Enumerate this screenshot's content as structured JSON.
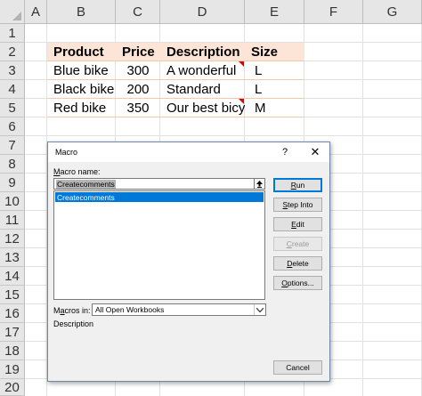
{
  "sheet": {
    "columns": [
      "A",
      "B",
      "C",
      "D",
      "E",
      "F",
      "G"
    ],
    "rows": [
      "1",
      "2",
      "3",
      "4",
      "5",
      "6",
      "7",
      "8",
      "9",
      "10",
      "11",
      "12",
      "13",
      "14",
      "15",
      "16",
      "17",
      "18",
      "19",
      "20"
    ],
    "table": {
      "headers": [
        "Product",
        "Price",
        "Description",
        "Size"
      ],
      "rows": [
        [
          "Blue bike",
          "300",
          "A wonderful",
          "L"
        ],
        [
          "Black bike",
          "200",
          "Standard",
          "L"
        ],
        [
          "Red bike",
          "350",
          "Our best bicy",
          "M"
        ]
      ],
      "header_fill": "#fce4d6",
      "comment_color": "#e00000"
    }
  },
  "dialog": {
    "title": "Macro",
    "help_icon": "question-mark-icon",
    "help": "?",
    "close_icon": "close-icon",
    "close": "✕",
    "macro_name_label_first": "M",
    "macro_name_label_rest": "acro name:",
    "macro_name_value": "Createcomments",
    "macro_list": [
      "Createcomments"
    ],
    "upload_icon": "upload-arrow-icon",
    "buttons": {
      "run": {
        "first": "R",
        "rest": "un"
      },
      "step_into": {
        "first": "S",
        "rest": "tep Into"
      },
      "edit": {
        "first": "E",
        "rest": "dit"
      },
      "create": {
        "first": "C",
        "rest": "reate"
      },
      "delete": {
        "first": "D",
        "rest": "elete"
      },
      "options": {
        "first": "O",
        "rest": "ptions..."
      },
      "cancel": "Cancel"
    },
    "macros_in_label_first": "M",
    "macros_in_label_mid": "a",
    "macros_in_label_rest": "cros in:",
    "macros_in_value": "All Open Workbooks",
    "description_label": "Description",
    "selection_color": "#0078d7"
  }
}
